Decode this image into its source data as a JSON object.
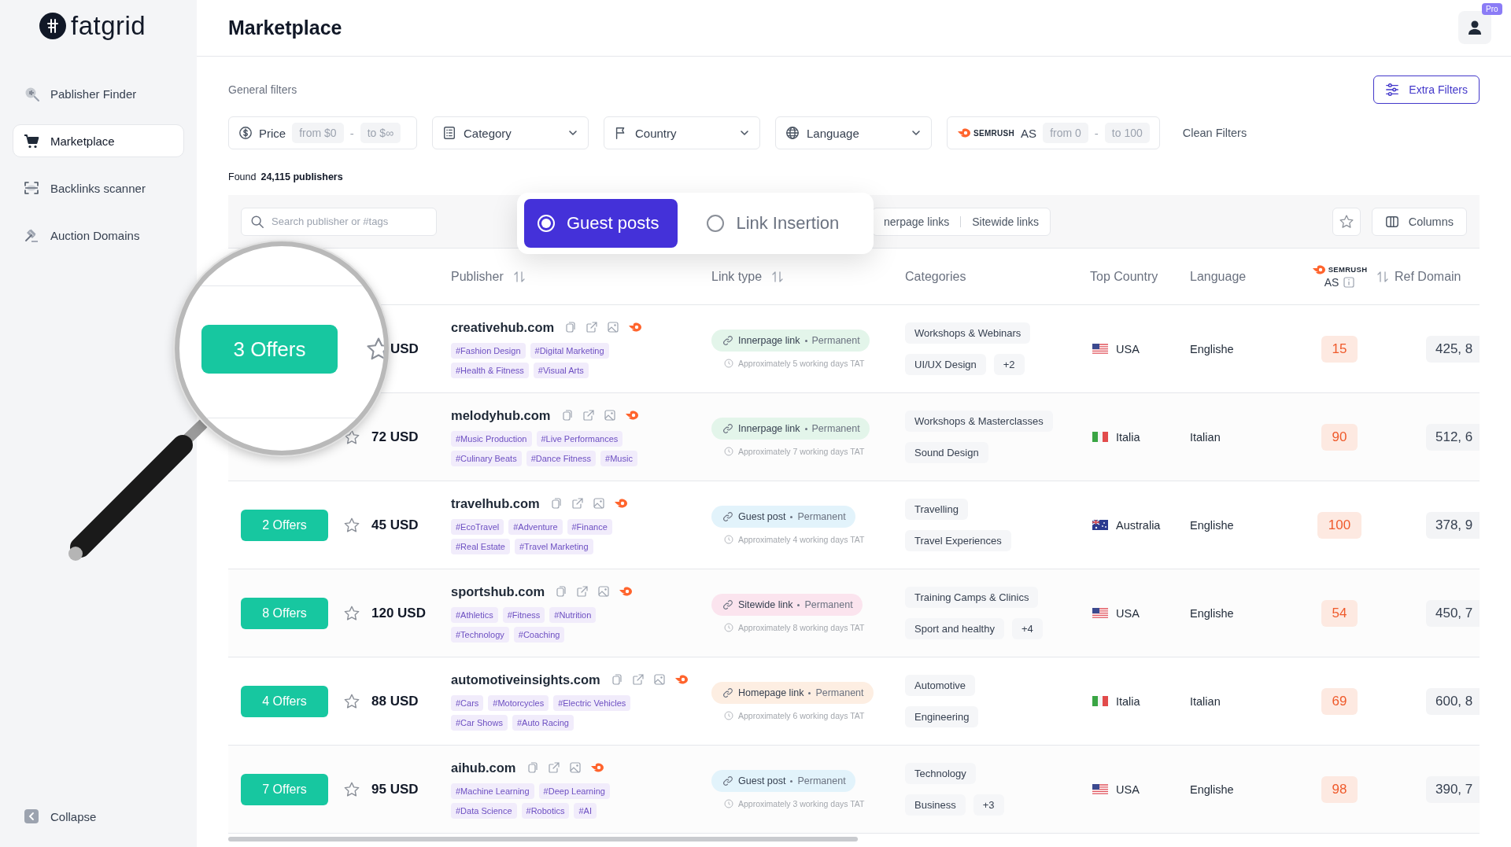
{
  "sidebar": {
    "logo": "fatgrid",
    "items": [
      {
        "label": "Pablisher Finder",
        "selected": false
      },
      {
        "label": "Marketplace",
        "selected": true
      },
      {
        "label": "Backlinks scanner",
        "selected": false
      },
      {
        "label": "Auction Domains",
        "selected": false
      }
    ],
    "collapse": "Collapse"
  },
  "header": {
    "title": "Marketplace",
    "badge": "Pro"
  },
  "filters": {
    "label": "General filters",
    "extra_button": "Extra Filters",
    "price": {
      "label": "Price",
      "from": "from $0",
      "separator": "-",
      "to": "to $∞"
    },
    "dropdowns": [
      {
        "label": "Category"
      },
      {
        "label": "Country"
      },
      {
        "label": "Language"
      }
    ],
    "semrush": {
      "logo": "SEMRUSH",
      "label": "AS",
      "from": "from 0",
      "separator": "-",
      "to": "to 100"
    },
    "clean": "Clean Filters"
  },
  "found": {
    "label": "Found",
    "count": "24,115 publishers"
  },
  "toolbar": {
    "search": {
      "placeholder": "Search publisher or #tags"
    },
    "link_tabs": [
      "nerpage links",
      "Sitewide links"
    ],
    "columns_button": "Columns"
  },
  "popup": {
    "options": [
      {
        "label": "Guest posts",
        "selected": true
      },
      {
        "label": "Link Insertion",
        "selected": false
      }
    ]
  },
  "table": {
    "columns": [
      {
        "kind": "text",
        "label": "Publisher",
        "sortable": true
      },
      {
        "kind": "text",
        "label": "Link type",
        "sortable": true
      },
      {
        "kind": "text",
        "label": "Categories",
        "sortable": false
      },
      {
        "kind": "text",
        "label": "Top Country",
        "sortable": false
      },
      {
        "kind": "text",
        "label": "Language",
        "sortable": false
      },
      {
        "kind": "semrush",
        "logo": "SEMRUSH",
        "label": "AS",
        "sortable": true
      },
      {
        "kind": "text",
        "label": "Ref Domain",
        "sortable": false
      }
    ],
    "rows": [
      {
        "magnified": true,
        "offers": "3 Offers",
        "price": "USD",
        "publisher": "creativehub.com",
        "tags": [
          "#Fashion Design",
          "#Digital Marketing",
          "#Health & Fitness",
          "#Visual Arts"
        ],
        "link": {
          "kind": "innerpage",
          "type": "Innerpage link",
          "term": "Permanent",
          "tat": "Approximately 5 working days TAT"
        },
        "categories": [
          {
            "kind": "category",
            "label": "Workshops & Webinars"
          },
          {
            "kind": "category",
            "label": "UI/UX Design"
          },
          {
            "kind": "more",
            "label": "+2"
          }
        ],
        "country": {
          "kind": "us",
          "name": "USA"
        },
        "language": "Englishe",
        "as": "15",
        "ref": "425, 8"
      },
      {
        "magnified": false,
        "price": "72 USD",
        "publisher": "melodyhub.com",
        "tags": [
          "#Music Production",
          "#Live Performances",
          "#Culinary Beats",
          "#Dance Fitness",
          "#Music"
        ],
        "link": {
          "kind": "innerpage",
          "type": "Innerpage link",
          "term": "Permanent",
          "tat": "Approximately 7 working days TAT"
        },
        "categories": [
          {
            "kind": "category",
            "label": "Workshops & Masterclasses"
          },
          {
            "kind": "category",
            "label": "Sound Design"
          }
        ],
        "country": {
          "kind": "it",
          "name": "Italia"
        },
        "language": "Italian",
        "as": "90",
        "ref": "512, 6"
      },
      {
        "magnified": false,
        "offers": "2 Offers",
        "price": "45 USD",
        "publisher": "travelhub.com",
        "tags": [
          "#EcoTravel",
          "#Adventure",
          "#Finance",
          "#Real Estate",
          "#Travel Marketing"
        ],
        "link": {
          "kind": "guest",
          "type": "Guest post",
          "term": "Permanent",
          "tat": "Approximately 4 working days TAT"
        },
        "categories": [
          {
            "kind": "category",
            "label": "Travelling"
          },
          {
            "kind": "category",
            "label": "Travel Experiences"
          }
        ],
        "country": {
          "kind": "au",
          "name": "Australia"
        },
        "language": "Englishe",
        "as": "100",
        "ref": "378, 9"
      },
      {
        "magnified": false,
        "offers": "8 Offers",
        "price": "120 USD",
        "publisher": "sportshub.com",
        "tags": [
          "#Athletics",
          "#Fitness",
          "#Nutrition",
          "#Technology",
          "#Coaching"
        ],
        "link": {
          "kind": "sitewide",
          "type": "Sitewide link",
          "term": "Permanent",
          "tat": "Approximately 8 working days TAT"
        },
        "categories": [
          {
            "kind": "category",
            "label": "Training Camps & Clinics"
          },
          {
            "kind": "category",
            "label": "Sport and healthy"
          },
          {
            "kind": "more",
            "label": "+4"
          }
        ],
        "country": {
          "kind": "us",
          "name": "USA"
        },
        "language": "Englishe",
        "as": "54",
        "ref": "450, 7"
      },
      {
        "magnified": false,
        "offers": "4 Offers",
        "price": "88 USD",
        "publisher": "automotiveinsights.com",
        "tags": [
          "#Cars",
          "#Motorcycles",
          "#Electric Vehicles",
          "#Car Shows",
          "#Auto Racing"
        ],
        "link": {
          "kind": "homepage",
          "type": "Homepage link",
          "term": "Permanent",
          "tat": "Approximately 6 working days TAT"
        },
        "categories": [
          {
            "kind": "category",
            "label": "Automotive"
          },
          {
            "kind": "category",
            "label": "Engineering"
          }
        ],
        "country": {
          "kind": "it",
          "name": "Italia"
        },
        "language": "Italian",
        "as": "69",
        "ref": "600, 8"
      },
      {
        "magnified": false,
        "offers": "7 Offers",
        "price": "95 USD",
        "publisher": "aihub.com",
        "tags": [
          "#Machine Learning",
          "#Deep Learning",
          "#Data Science",
          "#Robotics",
          "#AI"
        ],
        "link": {
          "kind": "guest",
          "type": "Guest post",
          "term": "Permanent",
          "tat": "Approximately 3 working days TAT"
        },
        "categories": [
          {
            "kind": "category",
            "label": "Technology"
          },
          {
            "kind": "category",
            "label": "Business"
          },
          {
            "kind": "more",
            "label": "+3"
          }
        ],
        "country": {
          "kind": "us",
          "name": "USA"
        },
        "language": "Englishe",
        "as": "98",
        "ref": "390, 7"
      }
    ]
  }
}
